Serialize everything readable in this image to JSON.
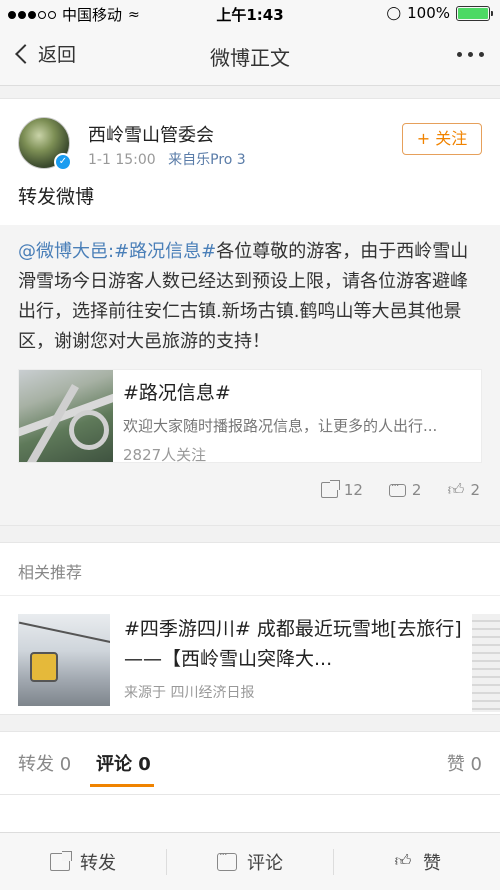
{
  "status_bar": {
    "carrier": "中国移动",
    "time": "上午1:43",
    "battery": "100%",
    "battery_level": 1.0
  },
  "nav": {
    "back_label": "返回",
    "title": "微博正文"
  },
  "post": {
    "author": "西岭雪山管委会",
    "time": "1-1 15:00",
    "source": "来自乐Pro 3",
    "follow_label": "+ 关注",
    "text": "转发微博",
    "original": {
      "mention": "@微博大邑:",
      "hashtag": "#路况信息#",
      "body": "各位尊敬的游客，由于西岭雪山滑雪场今日游客人数已经达到预设上限，请各位游客避峰出行，选择前往安仁古镇.新场古镇.鹤鸣山等大邑其他景区，谢谢您对大邑旅游的支持！"
    },
    "topic_card": {
      "title": "#路况信息#",
      "description": "欢迎大家随时播报路况信息，让更多的人出行...",
      "followers": "2827人关注"
    },
    "counts": {
      "reposts": "12",
      "comments": "2",
      "likes": "2"
    }
  },
  "related": {
    "header": "相关推荐",
    "item": {
      "title": "#四季游四川# 成都最近玩雪地[去旅行]——【西岭雪山突降大...",
      "source": "来源于 四川经济日报"
    }
  },
  "tabs": {
    "repost": "转发 0",
    "comment": "评论 0",
    "like": "赞 0"
  },
  "toolbar": {
    "repost": "转发",
    "comment": "评论",
    "like": "赞"
  },
  "colors": {
    "accent": "#f08300",
    "link": "#4a7fb8",
    "verified": "#1a9cf0"
  }
}
